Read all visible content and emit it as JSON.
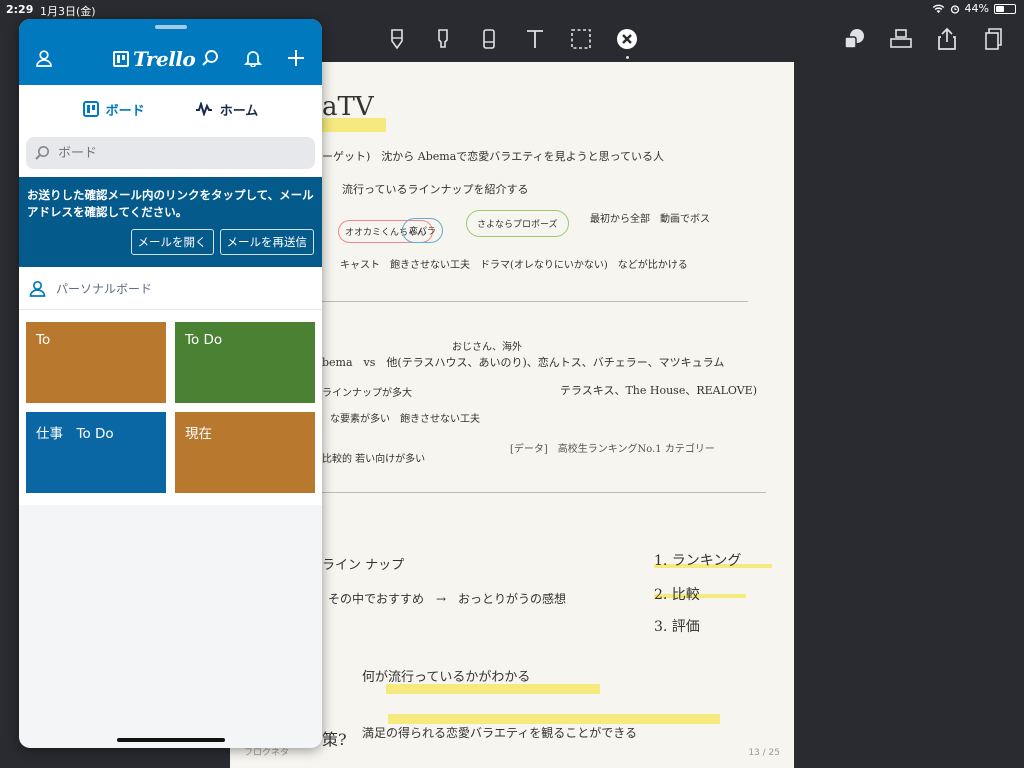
{
  "status": {
    "time": "2:29",
    "date": "1月3日(金)",
    "battery": "44%",
    "battery_level": 0.44
  },
  "colors": {
    "trello_blue": "#0079bf",
    "banner_blue": "#055a8c",
    "brown": "#b8792f",
    "green": "#4a8132",
    "blue": "#0b67a4"
  },
  "trello": {
    "logo": "Trello",
    "tabs": [
      {
        "label": "ボード",
        "icon": "board-icon"
      },
      {
        "label": "ホーム",
        "icon": "activity-icon"
      }
    ],
    "search_placeholder": "ボード",
    "banner": {
      "message": "お送りした確認メール内のリンクをタップして、メールアドレスを確認してください。",
      "open_mail": "メールを開く",
      "resend_mail": "メールを再送信"
    },
    "section_title": "パーソナルボード",
    "boards": [
      {
        "name": "To",
        "color": "#b8792f"
      },
      {
        "name": "To  Do",
        "color": "#4a8132"
      },
      {
        "name": "仕事　To Do",
        "color": "#0b67a4"
      },
      {
        "name": "現在",
        "color": "#b8792f"
      }
    ]
  },
  "notes": {
    "title": "aTV",
    "lines": [
      "ーゲット)　沈から Abemaで恋愛バラエティを見ようと思っている人",
      "流行っているラインナップを紹介する",
      "オオカミくんちゃん",
      "恋パラ",
      "さよならプロポーズ",
      "最初から全部　動画でボス",
      "キャスト　飽きさせない工夫　ドラマ(オレなりにいかない)　などが比かける",
      "おじさん、海外",
      "bema　vs　他(テラスハウス、あいのり)、恋んトス、バチェラー、マツキュラム",
      "テラスキス、The House、REALOVE)",
      "ラインナップが多大",
      "な要素が多い　飽きさせない工夫",
      "[データ]　高校生ランキングNo.1 カテゴリー",
      "比較的 若い向けが多い",
      "ライン ナップ",
      "その中でおすすめ　→　おっとりがうの感想",
      "1. ランキング",
      "2. 比較",
      "3. 評価",
      "何が流行っているかがわかる",
      "満足の得られる恋愛バラエティを観ることができる",
      "策?"
    ],
    "footer_left": "フロクネタ",
    "page": "13 / 25"
  }
}
